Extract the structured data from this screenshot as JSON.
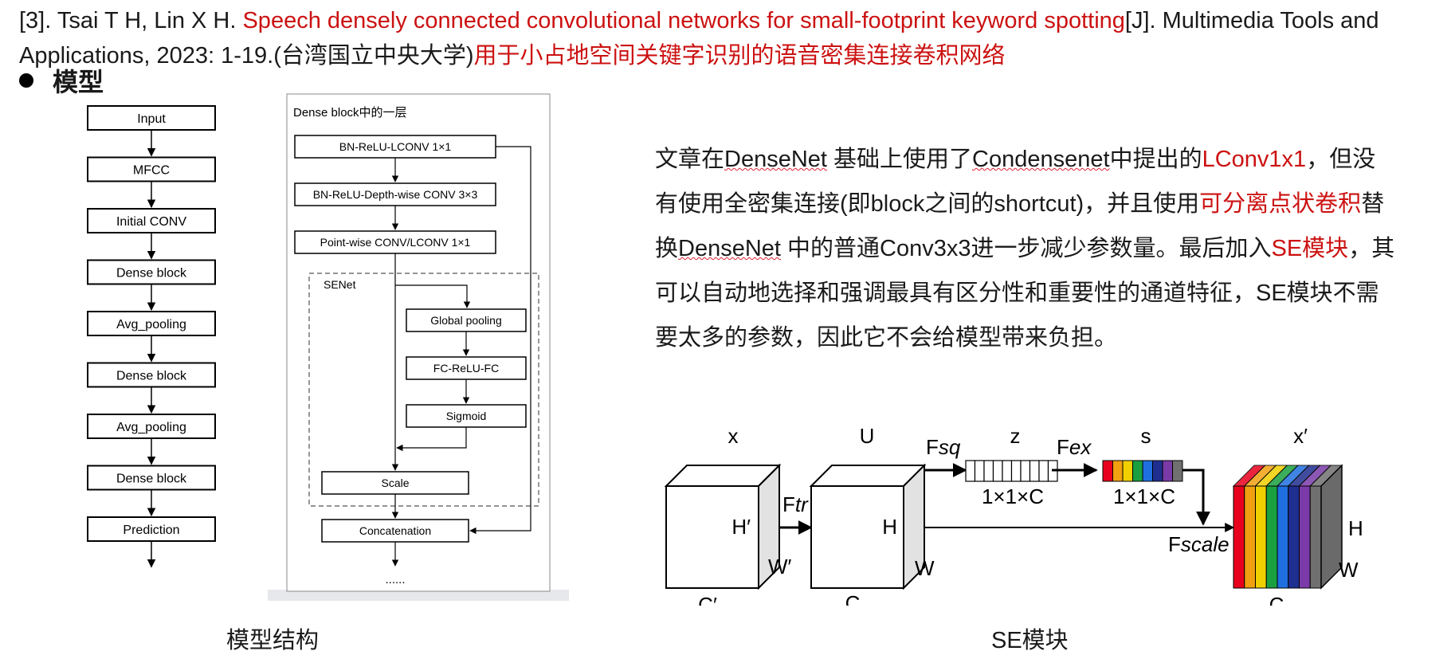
{
  "reference": {
    "number": "[3].",
    "authors": " Tsai T H, Lin X H. ",
    "title": "Speech densely connected convolutional networks for small-footprint keyword spotting",
    "journal": "[J]. Multimedia Tools and Applications, 2023: 1-19.(台湾国立中央大学)",
    "title_cn": "用于小占地空间关键字识别的语音密集连接卷积网络"
  },
  "section_heading": "模型",
  "model_flow": {
    "blocks": [
      "Input",
      "MFCC",
      "Initial CONV",
      "Dense block",
      "Avg_pooling",
      "Dense block",
      "Avg_pooling",
      "Dense block",
      "Prediction"
    ]
  },
  "dense_layer": {
    "title": "Dense block中的一层",
    "conv1": "BN-ReLU-LCONV 1×1",
    "conv2": "BN-ReLU-Depth-wise CONV 3×3",
    "conv3": "Point-wise CONV/LCONV 1×1",
    "senet_label": "SENet",
    "global_pool": "Global pooling",
    "fc": "FC-ReLU-FC",
    "sigmoid": "Sigmoid",
    "scale": "Scale",
    "concat": "Concatenation",
    "ellipsis": "......"
  },
  "description": {
    "p1": "文章在",
    "densenet": "DenseNet",
    "p2": " 基础上使用了",
    "condensenet": "Condensenet",
    "p3": "中提出的",
    "lconv": "LConv1x1",
    "p4": "，但没有使用全密集连接(即block之间的shortcut)，并且使用",
    "sep_conv": "可分离点状卷积",
    "p5": "替换",
    "densenet2": "DenseNet",
    "p6": " 中的普通Conv3x3进一步减少参数量。最后加入",
    "se_block": "SE模块",
    "p7": "，其可以自动地选择和强调最具有区分性和重要性的通道特征，SE模块不需要太多的参数，因此它不会给模型带来负担。"
  },
  "se_diagram": {
    "x": "x",
    "u": "U",
    "z": "z",
    "s": "s",
    "x_prime": "x′",
    "h_prime": "H′",
    "w_prime": "W′",
    "c_prime": "C′",
    "h": "H",
    "w": "W",
    "c": "C",
    "f_tr": [
      "F",
      "tr"
    ],
    "f_sq": [
      "F",
      "sq"
    ],
    "f_ex": [
      "F",
      "ex"
    ],
    "f_scale": [
      "F",
      "scale"
    ],
    "dim_z": "1×1×C",
    "dim_s": "1×1×C",
    "channel_colors": [
      "#e8001c",
      "#f0a010",
      "#f0d000",
      "#1aa040",
      "#1f6fe0",
      "#1f2f8f",
      "#7a3aa8",
      "#707070"
    ]
  },
  "captions": {
    "left": "模型结构",
    "right": "SE模块"
  }
}
